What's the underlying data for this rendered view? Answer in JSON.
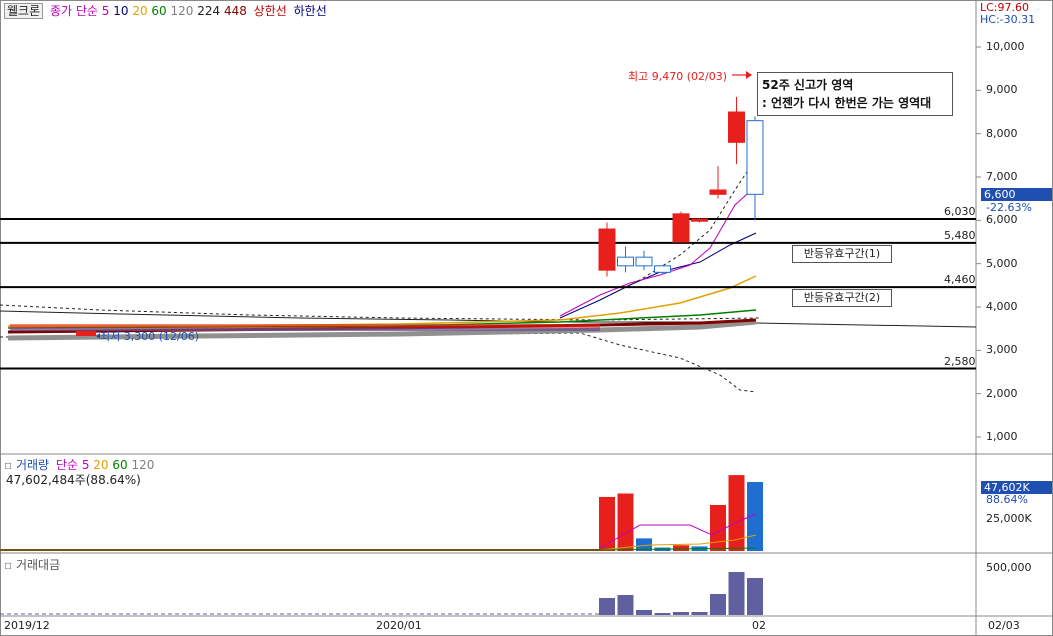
{
  "window": {
    "stock_name": "웰크론"
  },
  "header": {
    "label": "종가 단순",
    "ma_periods": [
      {
        "label": "5",
        "color": "#c000c0"
      },
      {
        "label": "10",
        "color": "#000080"
      },
      {
        "label": "20",
        "color": "#e0a000"
      },
      {
        "label": "60",
        "color": "#008000"
      },
      {
        "label": "120",
        "color": "#808080"
      },
      {
        "label": "224",
        "color": "#202020"
      },
      {
        "label": "448",
        "color": "#800000"
      }
    ],
    "upper_limit": "상한선",
    "lower_limit": "하한선",
    "label_color": "#c000c0"
  },
  "corner": {
    "lc": "LC:97.60",
    "hc": "HC:-30.31"
  },
  "price_panel": {
    "y_ticks": [
      "10,000",
      "9,000",
      "8,000",
      "7,000",
      "6,000",
      "5,000",
      "4,000",
      "3,000",
      "2,000",
      "1,000"
    ],
    "current_price": "6,600",
    "current_change": "-22.63%",
    "high_note": "최고 9,470 (02/03)",
    "low_note": "최저 3,300 (12/06)",
    "callout_line1": "52주 신고가 영역",
    "callout_line2": ": 언젠가 다시 한번은 가는 영역대",
    "levels": [
      {
        "value": 6030,
        "label": "6,030"
      },
      {
        "value": 5480,
        "label": "5,480"
      },
      {
        "value": 4460,
        "label": "4,460"
      },
      {
        "value": 2580,
        "label": "2,580"
      }
    ],
    "zone1": "반등유효구간(1)",
    "zone2": "반등유효구간(2)"
  },
  "volume_panel": {
    "title": "거래량",
    "ma_label": "단순",
    "ma_periods": [
      {
        "label": "5",
        "color": "#c000c0"
      },
      {
        "label": "20",
        "color": "#e0a000"
      },
      {
        "label": "60",
        "color": "#008000"
      },
      {
        "label": "120",
        "color": "#808080"
      }
    ],
    "summary": "47,602,484주(88.64%)",
    "current": "47,602K",
    "pct": "88.64%",
    "tick": "25,000K"
  },
  "value_panel": {
    "title": "거래대금",
    "tick": "500,000"
  },
  "x_axis": {
    "labels": [
      "2019/12",
      "2020/01",
      "02",
      "02/03"
    ]
  },
  "colors": {
    "up": "#e8201c",
    "down": "#1f6fd1",
    "accent": "#1f4fb0",
    "value_bar": "#6060a0"
  },
  "chart_data": {
    "type": "candlestick",
    "y_unit": "KRW",
    "ylim": [
      600,
      10600
    ],
    "candles": [
      {
        "o": 5800,
        "h": 5950,
        "l": 4700,
        "c": 4850,
        "dir": "up"
      },
      {
        "o": 4950,
        "h": 5400,
        "l": 4800,
        "c": 5150,
        "dir": "down"
      },
      {
        "o": 5150,
        "h": 5300,
        "l": 4850,
        "c": 4950,
        "dir": "down"
      },
      {
        "o": 4950,
        "h": 4950,
        "l": 4750,
        "c": 4800,
        "dir": "down"
      },
      {
        "o": 6150,
        "h": 6200,
        "l": 5500,
        "c": 5500,
        "dir": "up"
      },
      {
        "o": 6030,
        "h": 6050,
        "l": 5950,
        "c": 5980,
        "dir": "up"
      },
      {
        "o": 6700,
        "h": 7250,
        "l": 6500,
        "c": 6600,
        "dir": "up"
      },
      {
        "o": 8500,
        "h": 8850,
        "l": 7300,
        "c": 7800,
        "dir": "up"
      },
      {
        "o": 8300,
        "h": 8400,
        "l": 6000,
        "c": 6600,
        "dir": "down"
      }
    ],
    "volume_bars": [
      {
        "v": 47,
        "dir": "up"
      },
      {
        "v": 50,
        "dir": "up"
      },
      {
        "v": 11,
        "dir": "down"
      },
      {
        "v": 3,
        "dir": "down"
      },
      {
        "v": 5,
        "dir": "up"
      },
      {
        "v": 4,
        "dir": "down"
      },
      {
        "v": 40,
        "dir": "up"
      },
      {
        "v": 66,
        "dir": "up"
      },
      {
        "v": 60,
        "dir": "down"
      }
    ],
    "value_bars": [
      17,
      20,
      5,
      2,
      3,
      3,
      21,
      43,
      37
    ]
  }
}
